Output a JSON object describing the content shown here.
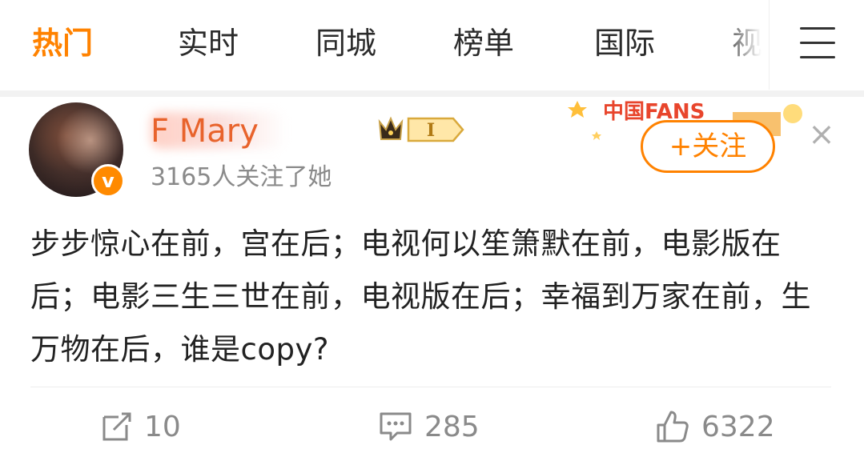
{
  "tabs": [
    {
      "label": "热门",
      "active": true
    },
    {
      "label": "实时",
      "active": false
    },
    {
      "label": "同城",
      "active": false
    },
    {
      "label": "榜单",
      "active": false
    },
    {
      "label": "国际",
      "active": false
    },
    {
      "label": "视",
      "active": false
    }
  ],
  "menu": {
    "icon": "hamburger-menu-icon"
  },
  "post": {
    "author": {
      "name": "F            Mary",
      "verified_icon": "v",
      "level_badge": "I",
      "followers": "3165人关注了她"
    },
    "banner": {
      "text": "中国FANS"
    },
    "follow_label": "+关注",
    "close_icon": "×",
    "text": "步步惊心在前，宫在后；电视何以笙箫默在前，电影版在后；电影三生三世在前，电视版在后；幸福到万家在前，生万物在后，谁是copy?",
    "actions": {
      "repost": "10",
      "comment": "285",
      "like": "6322"
    }
  },
  "colors": {
    "accent": "#ff8200",
    "text": "#222222",
    "muted": "#8a8a8a"
  }
}
